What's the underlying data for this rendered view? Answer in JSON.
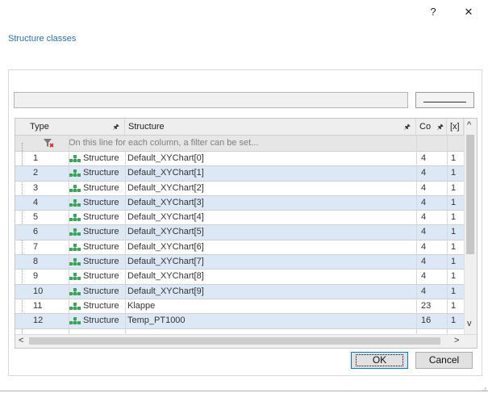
{
  "window": {
    "help_label": "?",
    "close_label": "✕"
  },
  "section_title": "Structure classes",
  "grid": {
    "columns": [
      "Type",
      "Structure",
      "Co",
      "[x]"
    ],
    "filter_placeholder": "On this line for each column, a filter can be set...",
    "rows": [
      {
        "num": "1",
        "type": "Structure",
        "name": "Default_XYChart[0]",
        "co": "4",
        "x": "1"
      },
      {
        "num": "2",
        "type": "Structure",
        "name": "Default_XYChart[1]",
        "co": "4",
        "x": "1"
      },
      {
        "num": "3",
        "type": "Structure",
        "name": "Default_XYChart[2]",
        "co": "4",
        "x": "1"
      },
      {
        "num": "4",
        "type": "Structure",
        "name": "Default_XYChart[3]",
        "co": "4",
        "x": "1"
      },
      {
        "num": "5",
        "type": "Structure",
        "name": "Default_XYChart[4]",
        "co": "4",
        "x": "1"
      },
      {
        "num": "6",
        "type": "Structure",
        "name": "Default_XYChart[5]",
        "co": "4",
        "x": "1"
      },
      {
        "num": "7",
        "type": "Structure",
        "name": "Default_XYChart[6]",
        "co": "4",
        "x": "1"
      },
      {
        "num": "8",
        "type": "Structure",
        "name": "Default_XYChart[7]",
        "co": "4",
        "x": "1"
      },
      {
        "num": "9",
        "type": "Structure",
        "name": "Default_XYChart[8]",
        "co": "4",
        "x": "1"
      },
      {
        "num": "10",
        "type": "Structure",
        "name": "Default_XYChart[9]",
        "co": "4",
        "x": "1"
      },
      {
        "num": "11",
        "type": "Structure",
        "name": "Klappe",
        "co": "23",
        "x": "1"
      },
      {
        "num": "12",
        "type": "Structure",
        "name": "Temp_PT1000",
        "co": "16",
        "x": "1"
      }
    ]
  },
  "buttons": {
    "ok": "OK",
    "cancel": "Cancel"
  },
  "colors": {
    "accent_title": "#2a6fb0",
    "row_alt": "#dde8f6",
    "structure_icon": "#3aa657"
  },
  "icons": [
    "filter-clear-icon",
    "structure-icon",
    "pin-icon",
    "help-icon",
    "close-icon"
  ]
}
